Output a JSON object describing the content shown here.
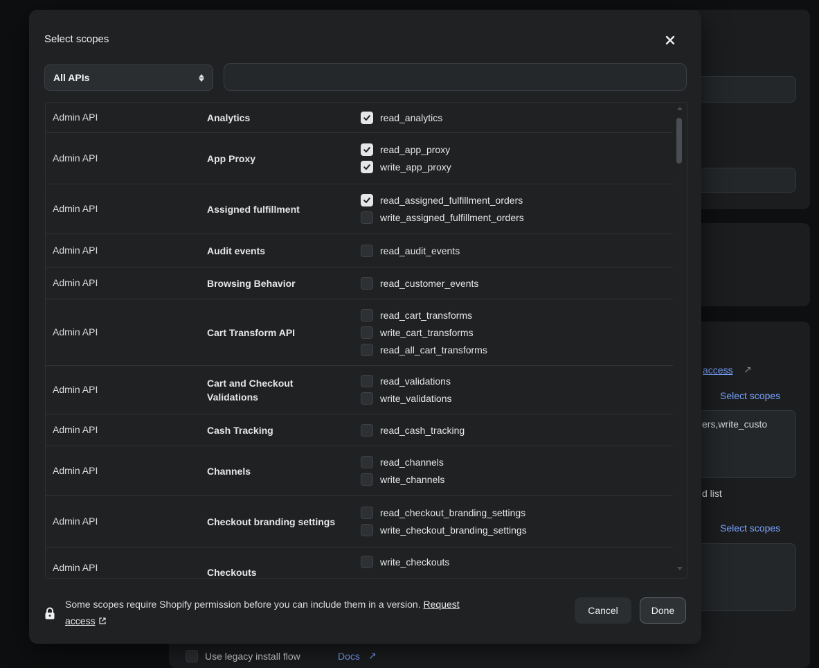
{
  "modal": {
    "title": "Select scopes",
    "api_filter": {
      "selected": "All APIs",
      "options": [
        "All APIs"
      ]
    },
    "search": {
      "value": "",
      "placeholder": ""
    },
    "rows": [
      {
        "api": "Admin API",
        "group": "Analytics",
        "scopes": [
          {
            "name": "read_analytics",
            "checked": true
          }
        ]
      },
      {
        "api": "Admin API",
        "group": "App Proxy",
        "scopes": [
          {
            "name": "read_app_proxy",
            "checked": true
          },
          {
            "name": "write_app_proxy",
            "checked": true
          }
        ]
      },
      {
        "api": "Admin API",
        "group": "Assigned fulfillment",
        "scopes": [
          {
            "name": "read_assigned_fulfillment_orders",
            "checked": true
          },
          {
            "name": "write_assigned_fulfillment_orders",
            "checked": false
          }
        ]
      },
      {
        "api": "Admin API",
        "group": "Audit events",
        "scopes": [
          {
            "name": "read_audit_events",
            "checked": false
          }
        ]
      },
      {
        "api": "Admin API",
        "group": "Browsing Behavior",
        "scopes": [
          {
            "name": "read_customer_events",
            "checked": false
          }
        ]
      },
      {
        "api": "Admin API",
        "group": "Cart Transform API",
        "scopes": [
          {
            "name": "read_cart_transforms",
            "checked": false
          },
          {
            "name": "write_cart_transforms",
            "checked": false
          },
          {
            "name": "read_all_cart_transforms",
            "checked": false
          }
        ]
      },
      {
        "api": "Admin API",
        "group": "Cart and Checkout Validations",
        "scopes": [
          {
            "name": "read_validations",
            "checked": false
          },
          {
            "name": "write_validations",
            "checked": false
          }
        ]
      },
      {
        "api": "Admin API",
        "group": "Cash Tracking",
        "scopes": [
          {
            "name": "read_cash_tracking",
            "checked": false
          }
        ]
      },
      {
        "api": "Admin API",
        "group": "Channels",
        "scopes": [
          {
            "name": "read_channels",
            "checked": false
          },
          {
            "name": "write_channels",
            "checked": false
          }
        ]
      },
      {
        "api": "Admin API",
        "group": "Checkout branding settings",
        "scopes": [
          {
            "name": "read_checkout_branding_settings",
            "checked": false
          },
          {
            "name": "write_checkout_branding_settings",
            "checked": false
          }
        ]
      },
      {
        "api": "Admin API",
        "group": "Checkouts",
        "scopes": [
          {
            "name": "write_checkouts",
            "checked": false
          }
        ]
      }
    ],
    "footer": {
      "notice": "Some scopes require Shopify permission before you can include them in a version.",
      "request_label": "Request",
      "access_label": "access"
    },
    "cancel_label": "Cancel",
    "done_label": "Done"
  },
  "background": {
    "access_link": "access",
    "select_scopes_1": "Select scopes",
    "scopes_text": "ers,write_custo",
    "list_text": "d list",
    "select_scopes_2": "Select scopes",
    "legacy_label": "Use legacy install flow",
    "docs_link": "Docs"
  }
}
